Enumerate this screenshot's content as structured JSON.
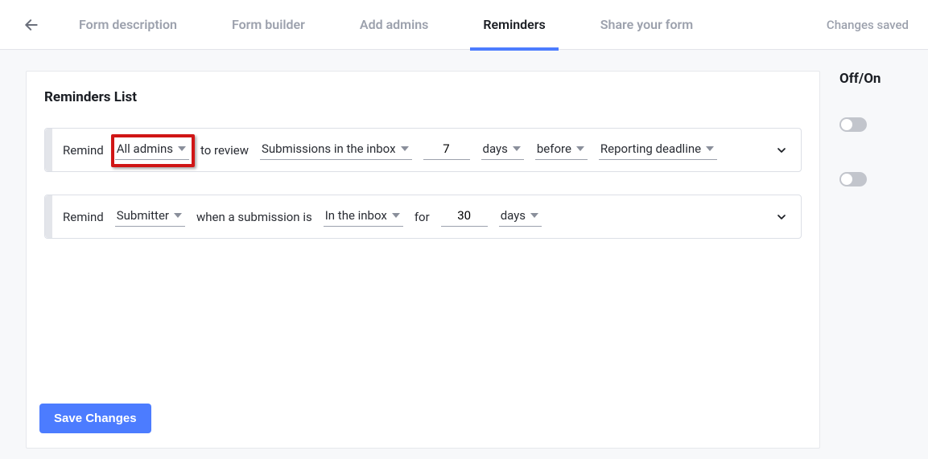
{
  "topbar": {
    "tabs": [
      {
        "label": "Form description"
      },
      {
        "label": "Form builder"
      },
      {
        "label": "Add admins"
      },
      {
        "label": "Reminders"
      },
      {
        "label": "Share your form"
      }
    ],
    "status": "Changes saved"
  },
  "panel": {
    "title": "Reminders List",
    "save_label": "Save Changes"
  },
  "aside": {
    "title": "Off/On"
  },
  "reminders": [
    {
      "prefix": "Remind",
      "who": "All admins",
      "mid1": "to review",
      "what": "Submissions in the inbox",
      "count": "7",
      "unit": "days",
      "relation": "before",
      "anchor": "Reporting deadline",
      "enabled": false
    },
    {
      "prefix": "Remind",
      "who": "Submitter",
      "mid1": "when a submission is",
      "what": "In the inbox",
      "mid2": "for",
      "count": "30",
      "unit": "days",
      "enabled": false
    }
  ]
}
